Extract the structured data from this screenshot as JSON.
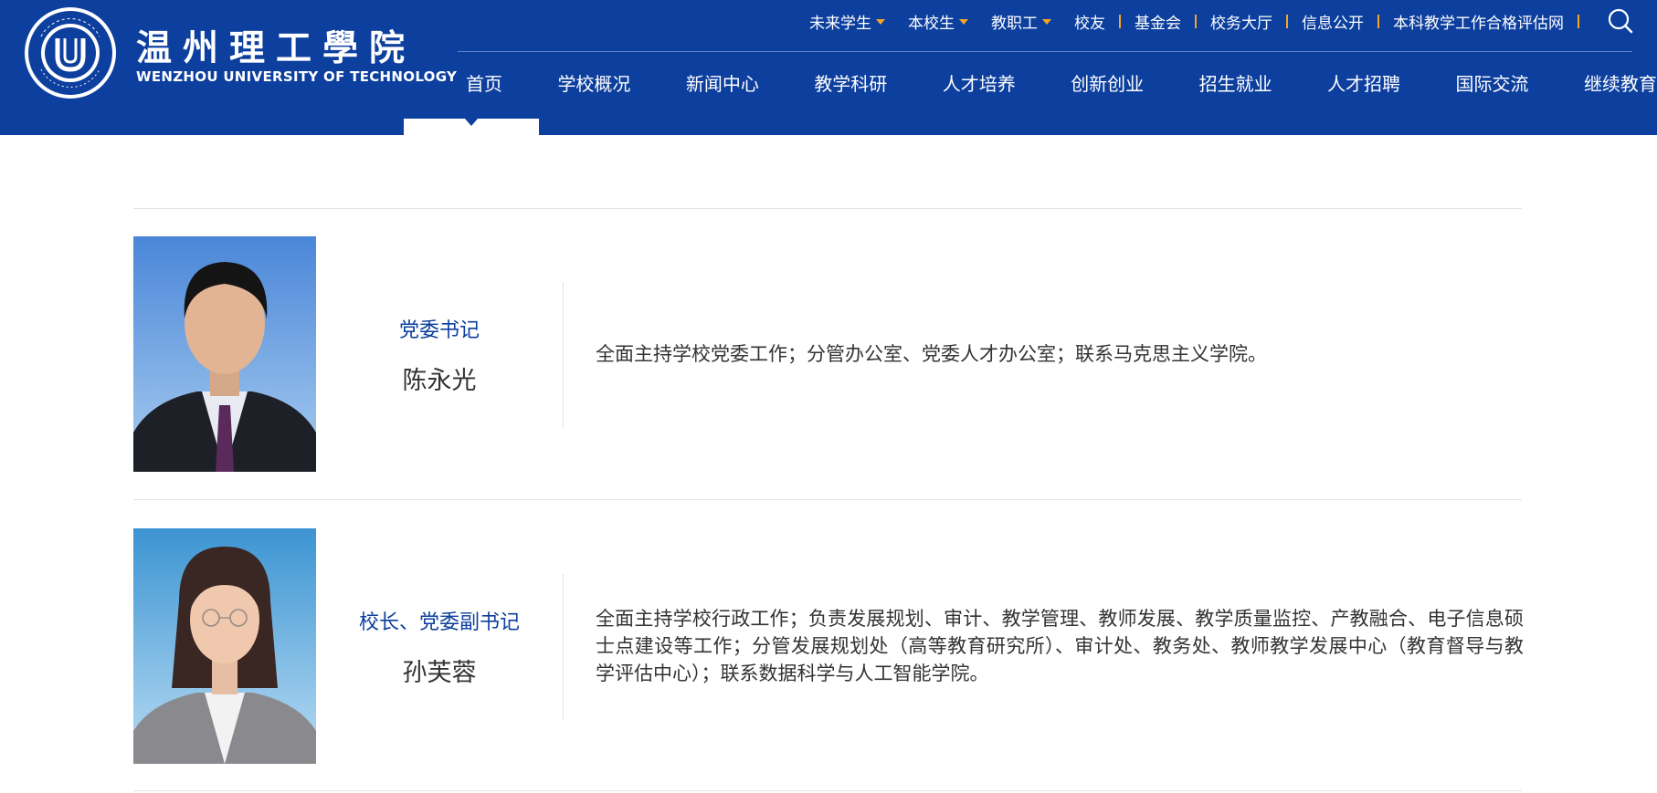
{
  "logo": {
    "cn_name": "温州理工學院",
    "en_name": "WENZHOU UNIVERSITY OF TECHNOLOGY",
    "seal_text": "温州理工学院 WENZHOU UNIVERSITY OF TECHNOLOGY"
  },
  "top_links": [
    {
      "label": "未来学生",
      "has_dropdown": true
    },
    {
      "label": "本校生",
      "has_dropdown": true
    },
    {
      "label": "教职工",
      "has_dropdown": true
    },
    {
      "label": "校友",
      "has_dropdown": false
    },
    {
      "label": "基金会",
      "has_dropdown": false
    },
    {
      "label": "校务大厅",
      "has_dropdown": false
    },
    {
      "label": "信息公开",
      "has_dropdown": false
    },
    {
      "label": "本科教学工作合格评估网",
      "has_dropdown": false
    }
  ],
  "search_icon": "search-icon",
  "main_nav": [
    "首页",
    "学校概况",
    "新闻中心",
    "教学科研",
    "人才培养",
    "创新创业",
    "招生就业",
    "人才招聘",
    "国际交流",
    "继续教育"
  ],
  "leaders": [
    {
      "position": "党委书记",
      "name": "陈永光",
      "duties": "全面主持学校党委工作；分管办公室、党委人才办公室；联系马克思主义学院。"
    },
    {
      "position": "校长、党委副书记",
      "name": "孙芙蓉",
      "duties": "全面主持学校行政工作；负责发展规划、审计、教学管理、教师发展、教学质量监控、产教融合、电子信息硕士点建设等工作；分管发展规划处（高等教育研究所）、审计处、教务处、教师教学发展中心（教育督导与教学评估中心）；联系数据科学与人工智能学院。"
    }
  ],
  "colors": {
    "header_bg": "#0c3f9e",
    "accent": "#f5a623",
    "position_text": "#0c3f9e",
    "body_text": "#333333"
  }
}
